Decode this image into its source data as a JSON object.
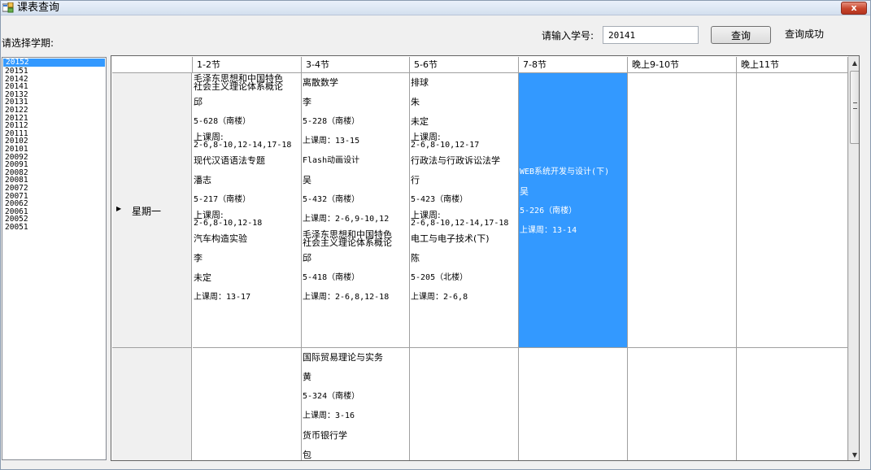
{
  "window": {
    "title": "课表查询",
    "close_symbol": "x"
  },
  "semester": {
    "label": "请选择学期:",
    "selected": "20152",
    "items": [
      "20152",
      "20151",
      "20142",
      "20141",
      "20132",
      "20131",
      "20122",
      "20121",
      "20112",
      "20111",
      "20102",
      "20101",
      "20092",
      "20091",
      "20082",
      "20081",
      "20072",
      "20071",
      "20062",
      "20061",
      "20052",
      "20051"
    ]
  },
  "search": {
    "label": "请输入学号:",
    "value": "20141",
    "button_label": "查询",
    "status": "查询成功"
  },
  "grid": {
    "columns": [
      "1-2节",
      "3-4节",
      "5-6节",
      "7-8节",
      "晚上9-10节",
      "晚上11节"
    ],
    "rows": [
      {
        "day": "星期一",
        "arrow": "▶",
        "cells": [
          [
            "毛泽东思想和中国特色",
            "社会主义理论体系概论",
            "邱",
            "5-628（南楼）",
            "上课周:",
            "2-6,8-10,12-14,17-18",
            "现代汉语语法专题",
            "潘志",
            "5-217（南楼）",
            "上课周:",
            "2-6,8-10,12-18",
            "汽车构造实验",
            "李",
            "未定",
            "上课周：13-17"
          ],
          [
            "离散数学",
            "李",
            "5-228（南楼）",
            "上课周：13-15",
            "Flash动画设计",
            "吴",
            "5-432（南楼）",
            "上课周：2-6,9-10,12",
            "毛泽东思想和中国特色",
            "社会主义理论体系概论",
            "邱",
            "5-418（南楼）",
            "上课周：2-6,8,12-18"
          ],
          [
            "排球",
            "朱",
            "未定",
            "上课周:",
            "2-6,8-10,12-17",
            "行政法与行政诉讼法学",
            "行",
            "5-423（南楼）",
            "上课周:",
            "2-6,8-10,12-14,17-18",
            "电工与电子技术(下)",
            "陈",
            "5-205（北楼）",
            "上课周：2-6,8"
          ],
          [
            "WEB系统开发与设计(下)",
            "吴",
            "5-226（南楼）",
            "上课周：13-14"
          ],
          [],
          []
        ]
      },
      {
        "day": "",
        "cells": [
          [],
          [
            "国际贸易理论与实务",
            "黄",
            "5-324（南楼）",
            "上课周：3-16",
            "货币银行学",
            "包"
          ],
          [],
          [],
          [],
          []
        ]
      }
    ]
  },
  "colors": {
    "selection": "#3399ff",
    "grid_line": "#a0a0a0",
    "row_header": "#f0f0f0"
  }
}
